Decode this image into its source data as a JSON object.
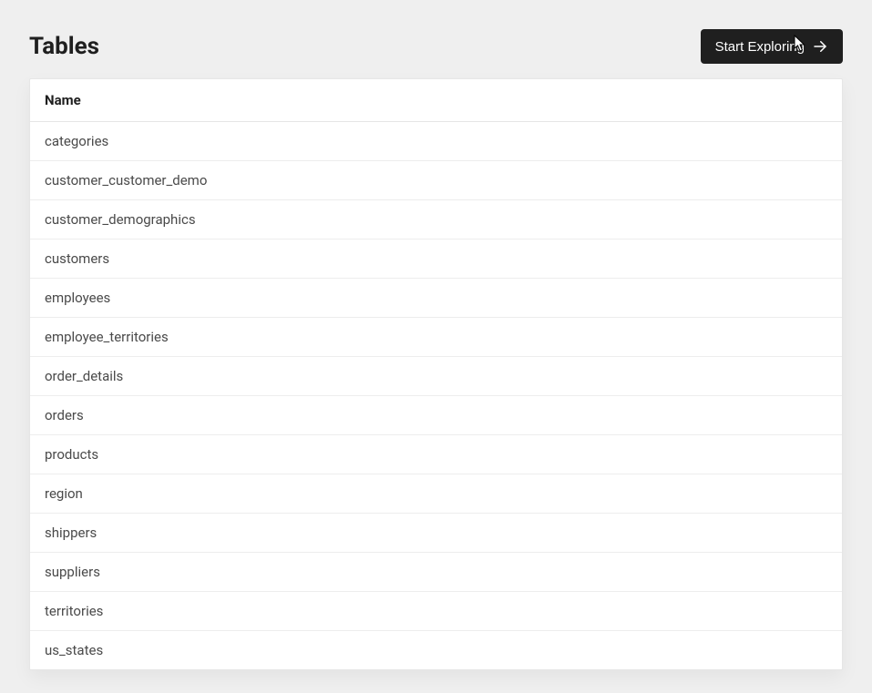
{
  "header": {
    "title": "Tables",
    "explore_label": "Start Exploring"
  },
  "table": {
    "column_header": "Name",
    "rows": [
      "categories",
      "customer_customer_demo",
      "customer_demographics",
      "customers",
      "employees",
      "employee_territories",
      "order_details",
      "orders",
      "products",
      "region",
      "shippers",
      "suppliers",
      "territories",
      "us_states"
    ]
  }
}
